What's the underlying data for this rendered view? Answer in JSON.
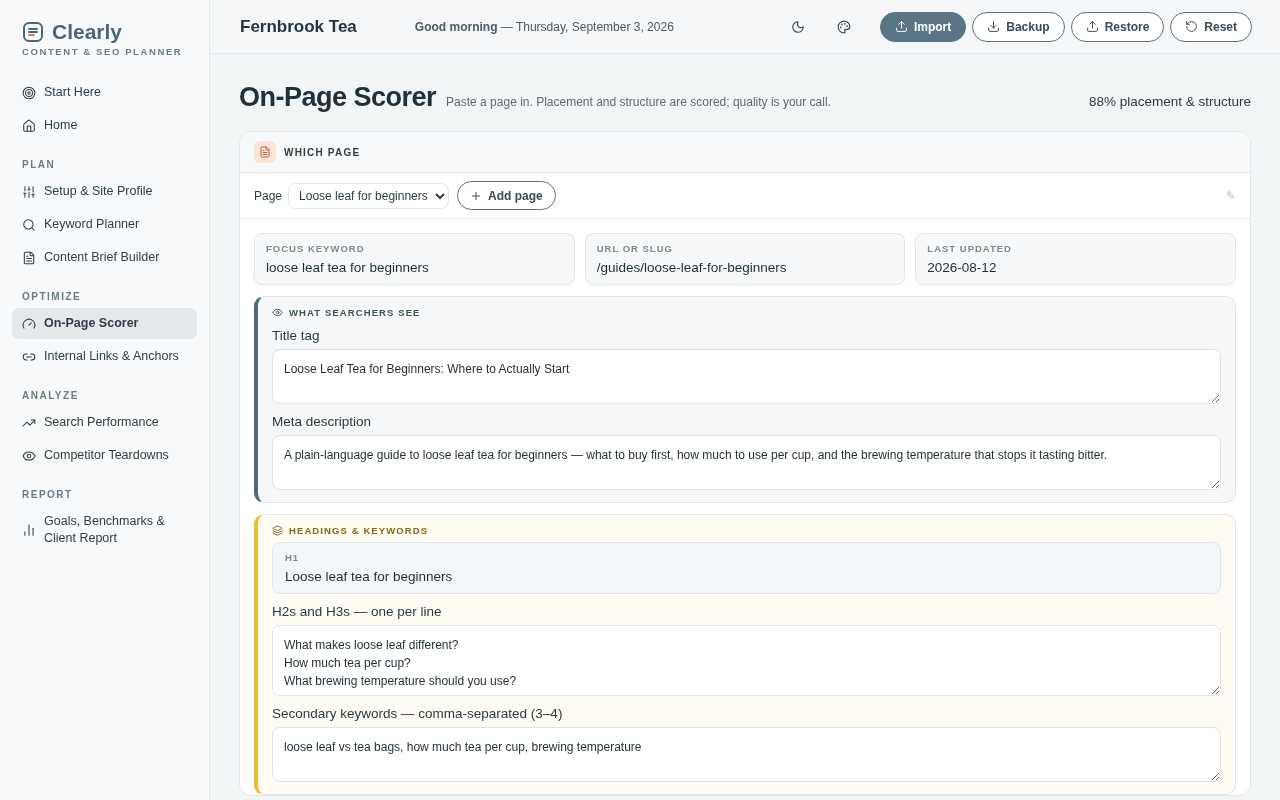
{
  "brand": {
    "name": "Clearly",
    "tagline": "CONTENT & SEO PLANNER"
  },
  "sidebar": {
    "sections": [
      {
        "items": [
          {
            "label": "Start Here",
            "selected": false
          },
          {
            "label": "Home",
            "selected": false
          }
        ]
      },
      {
        "heading": "PLAN",
        "items": [
          {
            "label": "Setup & Site Profile",
            "selected": false
          },
          {
            "label": "Keyword Planner",
            "selected": false
          },
          {
            "label": "Content Brief Builder",
            "selected": false
          }
        ]
      },
      {
        "heading": "OPTIMIZE",
        "items": [
          {
            "label": "On-Page Scorer",
            "selected": true
          },
          {
            "label": "Internal Links & Anchors",
            "selected": false
          }
        ]
      },
      {
        "heading": "ANALYZE",
        "items": [
          {
            "label": "Search Performance",
            "selected": false
          },
          {
            "label": "Competitor Teardowns",
            "selected": false
          }
        ]
      },
      {
        "heading": "REPORT",
        "items": [
          {
            "label": "Goals, Benchmarks & Client Report",
            "selected": false
          }
        ]
      }
    ]
  },
  "header": {
    "site": "Fernbrook Tea",
    "greeting": "Good morning",
    "date": "— Thursday, September 3, 2026",
    "buttons": [
      {
        "label": "Import",
        "primary": true
      },
      {
        "label": "Backup",
        "primary": false
      },
      {
        "label": "Restore",
        "primary": false
      },
      {
        "label": "Reset",
        "primary": false
      }
    ]
  },
  "page": {
    "title": "On-Page Scorer",
    "subtitle": "Paste a page in. Placement and structure are scored; quality is your call.",
    "score": "88% placement & structure"
  },
  "which_page": {
    "heading": "WHICH PAGE",
    "page_label": "Page",
    "page_value": "Loose leaf for beginners",
    "add_button": "Add page",
    "edit_glyph": "✎",
    "fields": [
      {
        "label": "FOCUS KEYWORD",
        "value": "loose leaf tea for beginners"
      },
      {
        "label": "URL OR SLUG",
        "value": "/guides/loose-leaf-for-beginners"
      },
      {
        "label": "LAST UPDATED",
        "value": "2026-08-12"
      }
    ]
  },
  "searchers": {
    "heading": "WHAT SEARCHERS SEE",
    "fields": [
      {
        "label": "Title tag",
        "value": "Loose Leaf Tea for Beginners: Where to Actually Start"
      },
      {
        "label": "Meta description",
        "value": "A plain-language guide to loose leaf tea for beginners — what to buy first, how much to use per cup, and the brewing temperature that stops it tasting bitter."
      }
    ]
  },
  "headings": {
    "heading": "HEADINGS & KEYWORDS",
    "h1_label": "H1",
    "h1_value": "Loose leaf tea for beginners",
    "subheads_label": "H2s and H3s — one per line",
    "subheads": [
      "What makes loose leaf different?",
      "How much tea per cup?",
      "What brewing temperature should you use?"
    ],
    "secondary_label": "Secondary keywords — comma-separated (3–4)",
    "secondary_value": "loose leaf vs tea bags, how much tea per cup, brewing temperature"
  }
}
